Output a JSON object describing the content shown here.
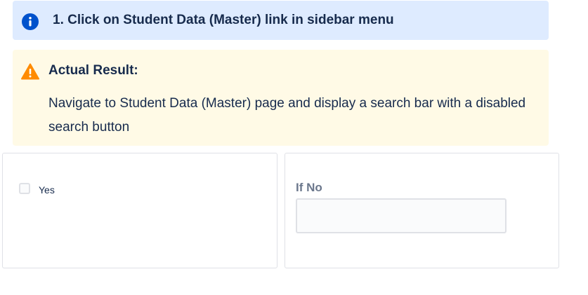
{
  "info_panel": {
    "icon": "info-circle-icon",
    "text": "1. Click on Student Data (Master) link in sidebar menu",
    "bg_color": "#deebff",
    "icon_color": "#0052cc"
  },
  "warning_panel": {
    "icon": "warning-triangle-icon",
    "title": "Actual Result:",
    "body": "Navigate to Student Data (Master) page and display a search bar with a disabled search button",
    "bg_color": "#fffae6",
    "icon_color": "#ff8b00"
  },
  "left_card": {
    "checkbox_label": "Yes",
    "checked": false
  },
  "right_card": {
    "field_label": "If No",
    "field_value": ""
  }
}
